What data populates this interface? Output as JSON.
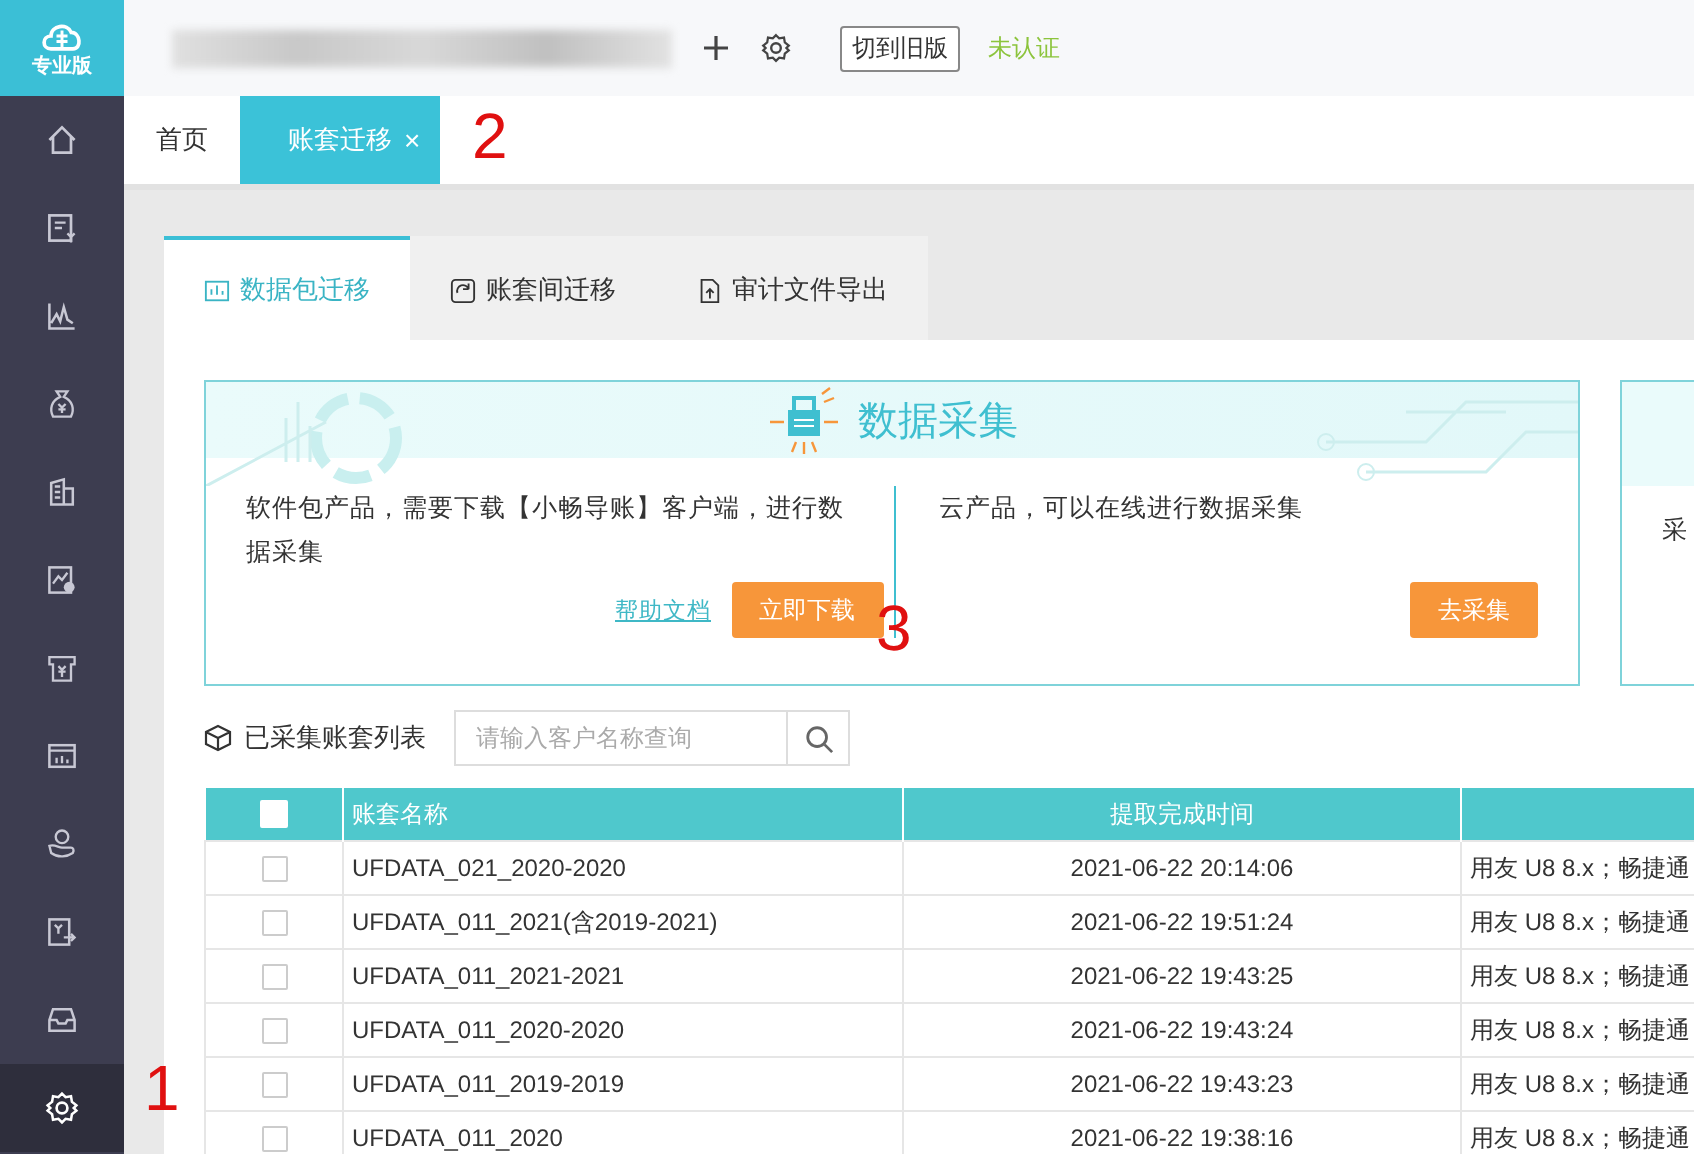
{
  "logo": {
    "label": "专业版"
  },
  "sidebar": {
    "items": [
      {
        "selected": false
      },
      {
        "selected": false
      },
      {
        "selected": false
      },
      {
        "selected": false
      },
      {
        "selected": false
      },
      {
        "selected": false
      },
      {
        "selected": false
      },
      {
        "selected": false
      },
      {
        "selected": false
      },
      {
        "selected": false
      },
      {
        "selected": false
      },
      {
        "selected": true
      }
    ]
  },
  "header": {
    "switch_button": "切到旧版",
    "status": "未认证"
  },
  "page_tabs": [
    {
      "label": "首页",
      "selected": false
    },
    {
      "label": "账套迁移",
      "selected": true,
      "close": "×"
    }
  ],
  "inner_tabs": [
    {
      "label": "数据包迁移",
      "selected": true
    },
    {
      "label": "账套间迁移",
      "selected": false
    },
    {
      "label": "审计文件导出",
      "selected": false
    }
  ],
  "card": {
    "title": "数据采集",
    "sections": [
      {
        "text": "软件包产品，需要下载【小畅导账】客户端，进行数据采集",
        "link": "帮助文档",
        "button": "立即下载"
      },
      {
        "text": "云产品，可以在线进行数据采集",
        "button": "去采集"
      }
    ]
  },
  "card_2": {
    "text": "采"
  },
  "list": {
    "title": "已采集账套列表",
    "search_placeholder": "请输入客户名称查询"
  },
  "table": {
    "header_checked": false,
    "columns": [
      "账套名称",
      "提取完成时间"
    ],
    "rows": [
      {
        "checked": false,
        "cells": [
          "UFDATA_021_2020-2020",
          "2021-06-22 20:14:06",
          "用友 U8 8.x；畅捷通"
        ]
      },
      {
        "checked": false,
        "cells": [
          "UFDATA_011_2021(含2019-2021)",
          "2021-06-22 19:51:24",
          "用友 U8 8.x；畅捷通"
        ]
      },
      {
        "checked": false,
        "cells": [
          "UFDATA_011_2021-2021",
          "2021-06-22 19:43:25",
          "用友 U8 8.x；畅捷通"
        ]
      },
      {
        "checked": false,
        "cells": [
          "UFDATA_011_2020-2020",
          "2021-06-22 19:43:24",
          "用友 U8 8.x；畅捷通"
        ]
      },
      {
        "checked": false,
        "cells": [
          "UFDATA_011_2019-2019",
          "2021-06-22 19:43:23",
          "用友 U8 8.x；畅捷通"
        ]
      },
      {
        "checked": false,
        "cells": [
          "UFDATA_011_2020",
          "2021-06-22 19:38:16",
          "用友 U8 8.x；畅捷通"
        ]
      }
    ]
  },
  "annotations": [
    "1",
    "2",
    "3"
  ]
}
